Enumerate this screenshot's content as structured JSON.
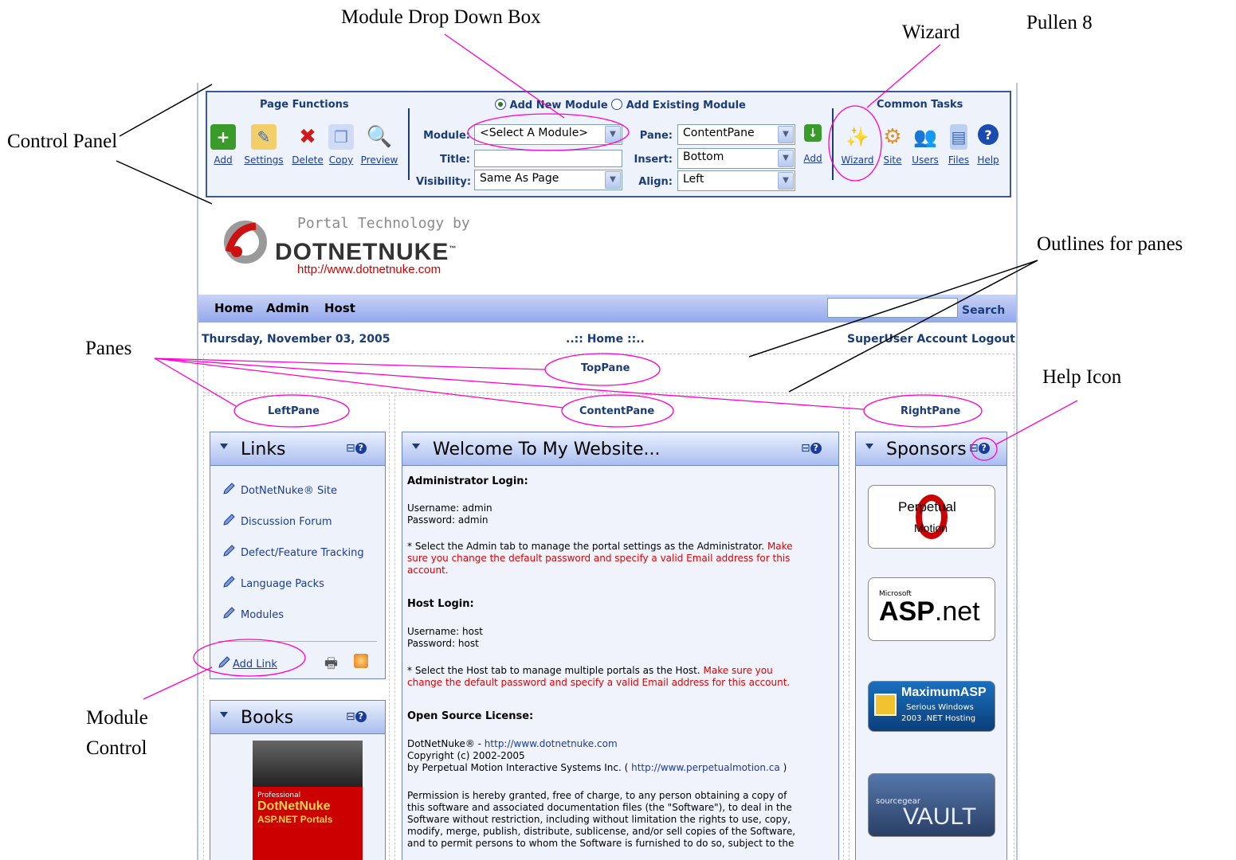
{
  "annotations": {
    "control_panel": "Control Panel",
    "module_drop_down": "Module Drop Down Box",
    "wizard": "Wizard",
    "pullen": "Pullen 8",
    "outlines": "Outlines for panes",
    "panes": "Panes",
    "help_icon": "Help Icon",
    "module_control_1": "Module",
    "module_control_2": "Control"
  },
  "control_panel": {
    "page_functions_title": "Page Functions",
    "page_functions": [
      {
        "label": "Add",
        "icon": "add-icon",
        "color": "#3a9a2a"
      },
      {
        "label": "Settings",
        "icon": "settings-icon",
        "color": "#e8a520"
      },
      {
        "label": "Delete",
        "icon": "delete-icon",
        "color": "#d01a1a"
      },
      {
        "label": "Copy",
        "icon": "copy-icon",
        "color": "#6d8fd0"
      },
      {
        "label": "Preview",
        "icon": "preview-icon",
        "color": "#7da0d8"
      }
    ],
    "radio_add_new": "Add New Module",
    "radio_add_existing": "Add Existing Module",
    "module_label": "Module:",
    "module_value": "<Select A Module>",
    "title_label": "Title:",
    "title_value": "",
    "visibility_label": "Visibility:",
    "visibility_value": "Same As Page",
    "pane_label": "Pane:",
    "pane_value": "ContentPane",
    "insert_label": "Insert:",
    "insert_value": "Bottom",
    "align_label": "Align:",
    "align_value": "Left",
    "add_label": "Add",
    "common_tasks_title": "Common Tasks",
    "common_tasks": [
      {
        "label": "Wizard",
        "icon": "wizard-icon"
      },
      {
        "label": "Site",
        "icon": "site-icon"
      },
      {
        "label": "Users",
        "icon": "users-icon"
      },
      {
        "label": "Files",
        "icon": "files-icon"
      },
      {
        "label": "Help",
        "icon": "help-icon"
      }
    ]
  },
  "header": {
    "logo_small": "Portal Technology by",
    "logo_big": "DOTNETNUKE",
    "logo_tm": "™",
    "logo_url": "http://www.dotnetnuke.com"
  },
  "nav": {
    "items": [
      "Home",
      "Admin",
      "Host"
    ],
    "search_button": "Search",
    "search_value": ""
  },
  "info": {
    "date": "Thursday, November 03, 2005",
    "breadcrumb": "..:: Home ::..",
    "user": "SuperUser Account",
    "logout": "Logout"
  },
  "panes": {
    "top": "TopPane",
    "left": "LeftPane",
    "content": "ContentPane",
    "right": "RightPane"
  },
  "links_module": {
    "title": "Links",
    "items": [
      "DotNetNuke® Site",
      "Discussion Forum",
      "Defect/Feature Tracking",
      "Language Packs",
      "Modules"
    ],
    "add_link": "Add Link"
  },
  "books_module": {
    "title": "Books",
    "cover_small": "Professional",
    "cover_title_1": "DotNetNuke",
    "cover_title_2": "ASP.NET Portals"
  },
  "welcome_module": {
    "title": "Welcome To My Website...",
    "admin_heading": "Administrator Login:",
    "admin_user": "Username: admin",
    "admin_pass": "Password: admin",
    "admin_note_1": "* Select the Admin tab to manage the portal settings as the Administrator.",
    "admin_note_red_1": "Make",
    "admin_note_red_2": "sure you change the default password and specify a valid Email address for this",
    "admin_note_red_3": "account.",
    "host_heading": "Host Login:",
    "host_user": "Username: host",
    "host_pass": "Password: host",
    "host_note_1": "* Select the Host tab to manage multiple portals as the Host.",
    "host_note_red_1": "Make sure you",
    "host_note_red_2": "change the default password and specify a valid Email address for this account.",
    "license_heading": "Open Source License:",
    "lic_1a": "DotNetNuke® - ",
    "lic_1b": "http://www.dotnetnuke.com",
    "lic_2": "Copyright (c) 2002-2005",
    "lic_3a": "by Perpetual Motion Interactive Systems Inc. ( ",
    "lic_3b": "http://www.perpetualmotion.ca",
    "lic_3c": " )",
    "perm_1": "Permission is hereby granted, free of charge, to any person obtaining a copy of",
    "perm_2": "this software and associated documentation files (the \"Software\"), to deal in the",
    "perm_3": "Software without restriction, including without limitation the rights to use, copy,",
    "perm_4": "modify, merge, publish, distribute, sublicense, and/or sell copies of the Software,",
    "perm_5": "and to permit persons to whom the Software is furnished to do so, subject to the"
  },
  "sponsors_module": {
    "title": "Sponsors",
    "s1_a": "Perpetual",
    "s1_b": "Motion",
    "s2_a": "Microsoft",
    "s2_b": "ASP",
    "s2_c": ".net",
    "s3_a": "MaximumASP",
    "s3_b": "Serious Windows",
    "s3_c": "2003 .NET Hosting",
    "s4_a": "sourcegear",
    "s4_b": "VAULT"
  },
  "colors": {
    "accent": "#1a3c78",
    "link": "#1a3c9c",
    "warning": "#e00000",
    "annotation_line": "#ff00cc"
  }
}
